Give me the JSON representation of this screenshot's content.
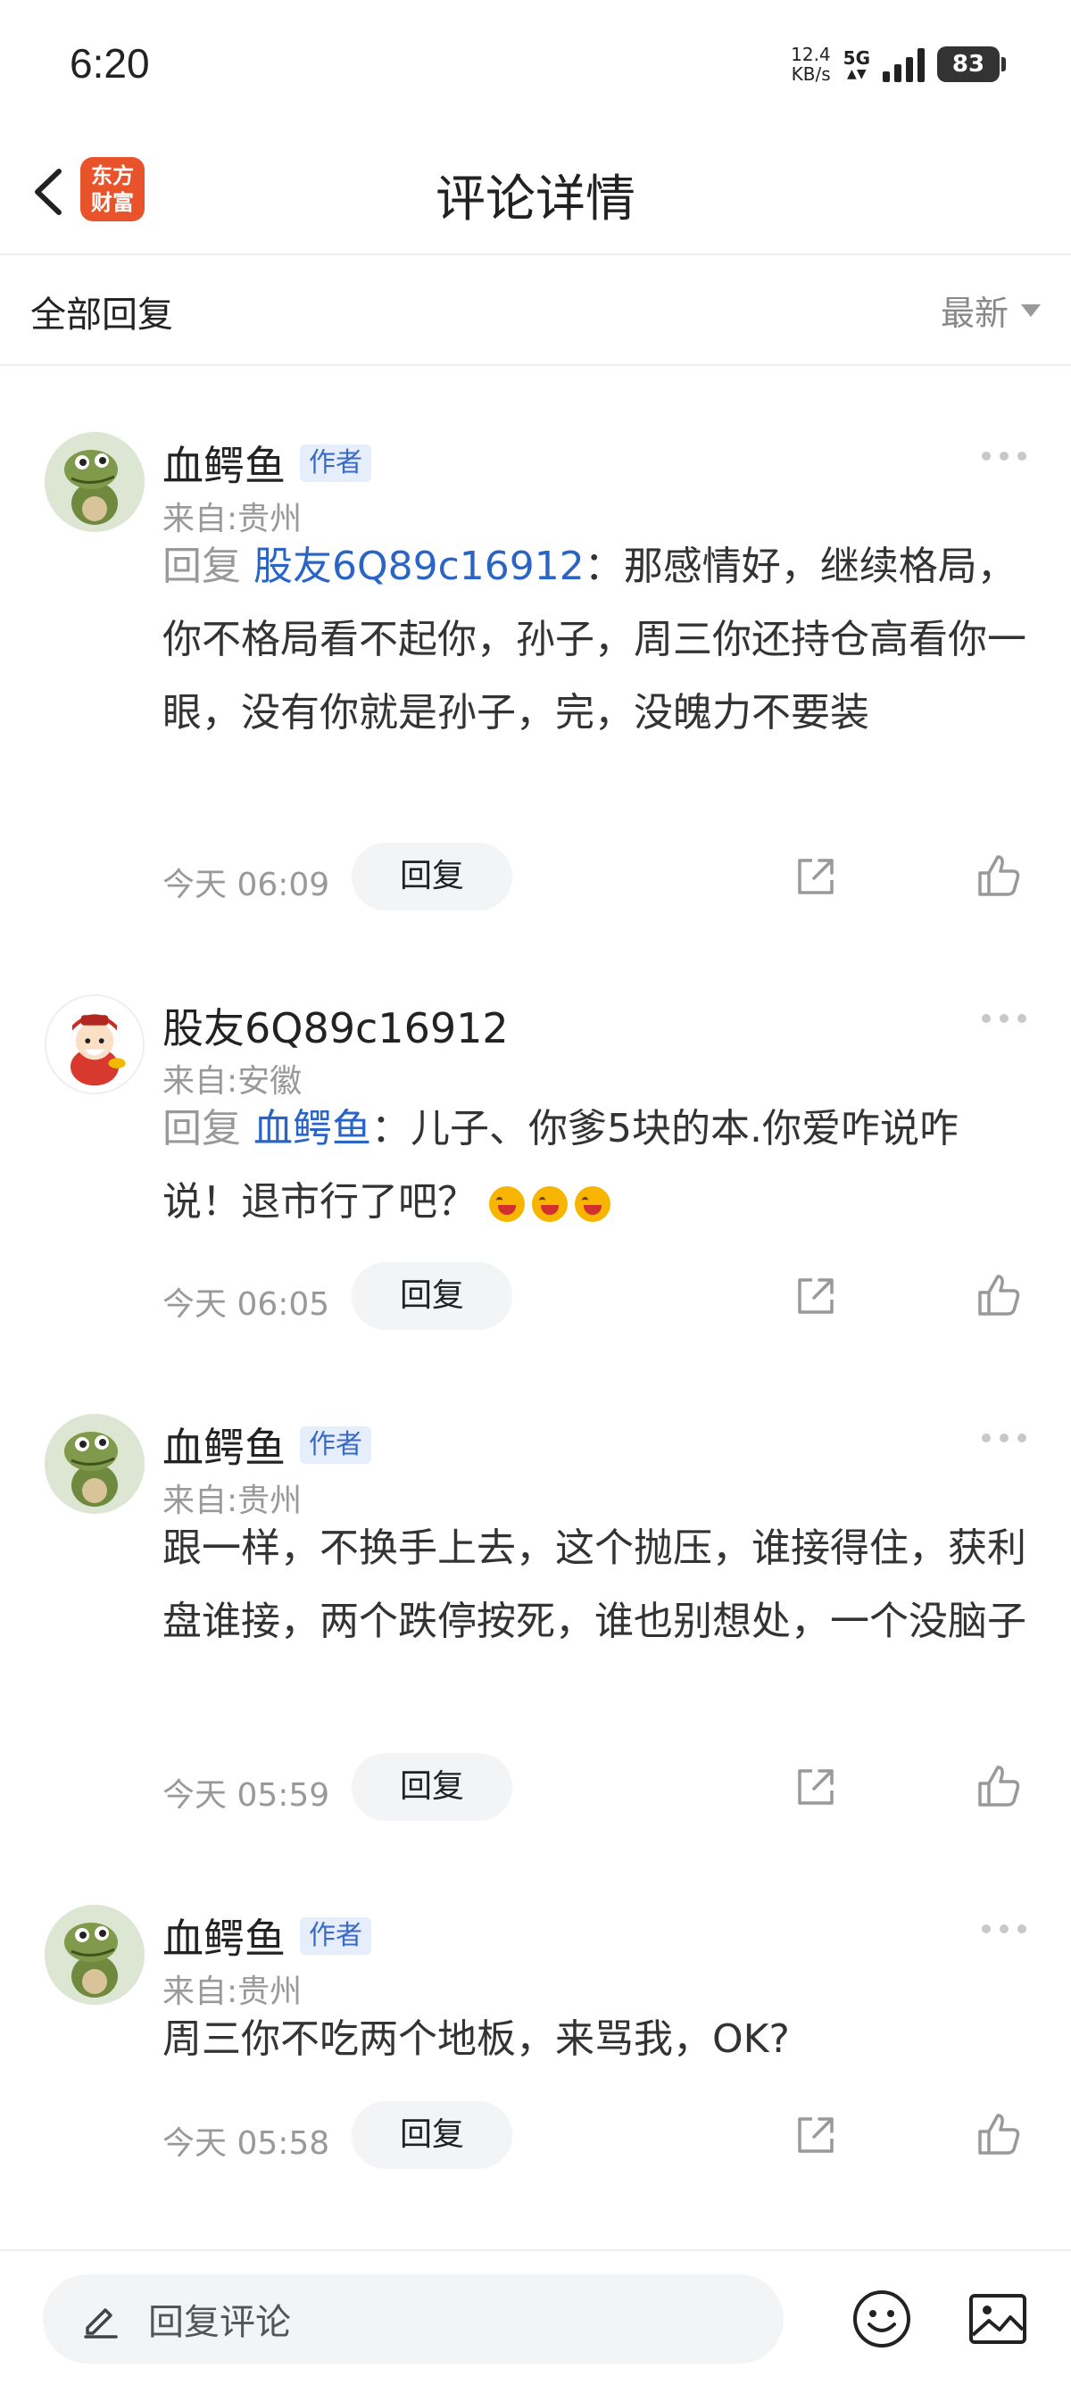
{
  "status_bar": {
    "time": "6:20",
    "net_speed_value": "12.4",
    "net_speed_unit": "KB/s",
    "network_type": "5G",
    "battery": "83"
  },
  "header": {
    "app_logo_line1": "东方",
    "app_logo_line2": "财富",
    "title": "评论详情"
  },
  "sort_bar": {
    "label": "全部回复",
    "sort_value": "最新"
  },
  "comments": [
    {
      "user": "血鳄鱼",
      "tag": "作者",
      "location": "来自:贵州",
      "reply_prefix": "回复",
      "mention": "股友6Q89c16912",
      "text": "：那感情好，继续格局，你不格局看不起你，孙子，周三你还持仓高看你一眼，没有你就是孙子，完，没魄力不要装",
      "time": "今天 06:09",
      "reply_label": "回复"
    },
    {
      "user": "股友6Q89c16912",
      "location": "来自:安徽",
      "reply_prefix": "回复",
      "mention": "血鳄鱼",
      "text": "：儿子、你爹5块的本.你爱咋说咋说！退市行了吧？",
      "time": "今天 06:05",
      "reply_label": "回复"
    },
    {
      "user": "血鳄鱼",
      "tag": "作者",
      "location": "来自:贵州",
      "text": "跟一样，不换手上去，这个抛压，谁接得住，获利盘谁接，两个跌停按死，谁也别想处，一个没脑子",
      "time": "今天 05:59",
      "reply_label": "回复"
    },
    {
      "user": "血鳄鱼",
      "tag": "作者",
      "location": "来自:贵州",
      "text": "周三你不吃两个地板，来骂我，OK?",
      "time": "今天 05:58",
      "reply_label": "回复"
    }
  ],
  "bottom_bar": {
    "input_placeholder": "回复评论"
  }
}
